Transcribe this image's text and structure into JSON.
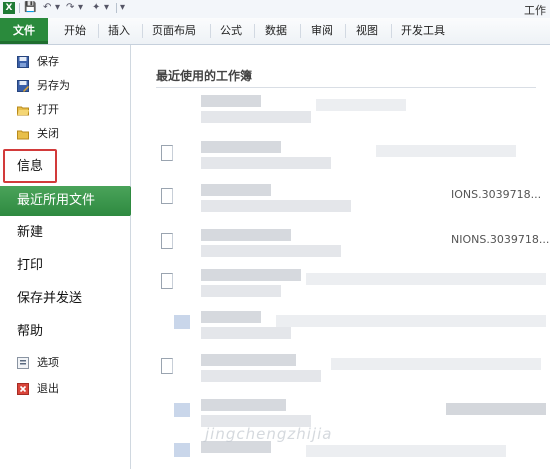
{
  "window": {
    "title": "工作"
  },
  "ribbon": {
    "tabs": [
      {
        "label": "文件"
      },
      {
        "label": "开始"
      },
      {
        "label": "插入"
      },
      {
        "label": "页面布局"
      },
      {
        "label": "公式"
      },
      {
        "label": "数据"
      },
      {
        "label": "审阅"
      },
      {
        "label": "视图"
      },
      {
        "label": "开发工具"
      }
    ]
  },
  "nav": {
    "items_small": [
      {
        "label": "保存",
        "icon": "save-icon"
      },
      {
        "label": "另存为",
        "icon": "save-as-icon"
      },
      {
        "label": "打开",
        "icon": "open-folder-icon"
      },
      {
        "label": "关闭",
        "icon": "close-folder-icon"
      }
    ],
    "info": "信息",
    "recent": "最近所用文件",
    "items_big": [
      {
        "label": "新建"
      },
      {
        "label": "打印"
      },
      {
        "label": "保存并发送"
      },
      {
        "label": "帮助"
      }
    ],
    "items_bottom": [
      {
        "label": "选项",
        "icon": "options-icon"
      },
      {
        "label": "退出",
        "icon": "exit-icon"
      }
    ]
  },
  "main": {
    "title": "最近使用的工作簿",
    "rows": [
      {
        "path": ""
      },
      {
        "path": ""
      },
      {
        "path": "IONS.3039718..."
      },
      {
        "path": "NIONS.3039718..."
      },
      {
        "path": ""
      },
      {
        "path": ""
      },
      {
        "path": ""
      },
      {
        "path": ""
      }
    ],
    "watermark": "jingchengzhijia"
  },
  "colors": {
    "file_tab": "#2a8a3c",
    "active_nav": "#2e8a40",
    "highlight": "#d23a3a"
  }
}
